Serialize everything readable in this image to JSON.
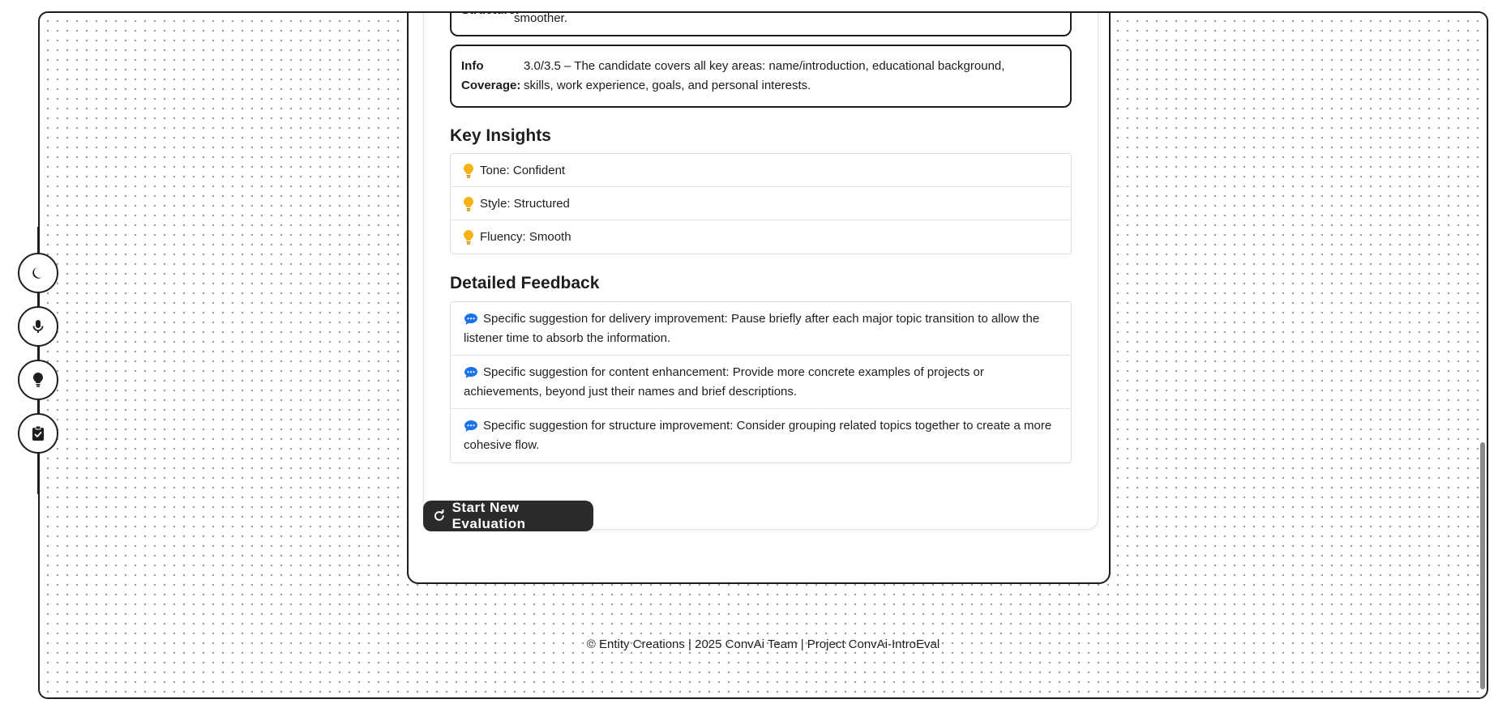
{
  "metrics": {
    "structure": {
      "label": "Structure:",
      "text": "smoother."
    },
    "info_coverage": {
      "label": "Info Coverage:",
      "text": "3.0/3.5 – The candidate covers all key areas: name/introduction, educational background, skills, work experience, goals, and personal interests."
    }
  },
  "key_insights": {
    "title": "Key Insights",
    "items": [
      {
        "label": "Tone: Confident"
      },
      {
        "label": "Style: Structured"
      },
      {
        "label": "Fluency: Smooth"
      }
    ]
  },
  "detailed_feedback": {
    "title": "Detailed Feedback",
    "items": [
      {
        "text": "Specific suggestion for delivery improvement: Pause briefly after each major topic transition to allow the listener time to absorb the information."
      },
      {
        "text": "Specific suggestion for content enhancement: Provide more concrete examples of projects or achievements, beyond just their names and brief descriptions."
      },
      {
        "text": "Specific suggestion for structure improvement: Consider grouping related topics together to create a more cohesive flow."
      }
    ]
  },
  "actions": {
    "start_new_label": "Start New Evaluation"
  },
  "footer": {
    "text": "© Entity Creations | 2025 ConvAi Team | Project ConvAi-IntroEval"
  },
  "side_nav": [
    {
      "icon": "moon-icon"
    },
    {
      "icon": "microphone-icon"
    },
    {
      "icon": "lightbulb-icon"
    },
    {
      "icon": "clipboard-check-icon"
    }
  ],
  "colors": {
    "accent_dark": "#2b2b2b",
    "bulb": "#f5b316",
    "chat": "#1a73e8"
  }
}
